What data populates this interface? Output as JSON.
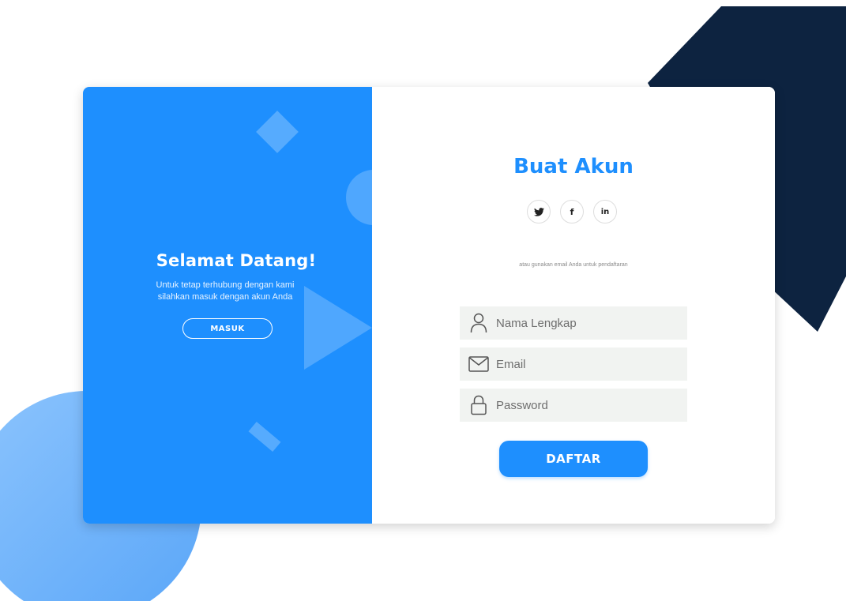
{
  "colors": {
    "accent": "#1e8ffe",
    "dark_shape": "#0d2340",
    "light_shape": "#7ab8fb",
    "field_bg": "#f1f3f1"
  },
  "welcome": {
    "title": "Selamat Datang!",
    "line1": "Untuk tetap terhubung dengan kami",
    "line2": "silahkan masuk dengan akun  Anda",
    "login_button": "MASUK"
  },
  "signup": {
    "title": "Buat Akun",
    "social": [
      {
        "icon": "twitter-icon",
        "glyph": "🐦"
      },
      {
        "icon": "facebook-icon",
        "glyph": "f"
      },
      {
        "icon": "linkedin-icon",
        "glyph": "in"
      }
    ],
    "hint": "atau gunakan email Anda untuk pendaftaran",
    "fields": {
      "name": {
        "placeholder": "Nama Lengkap",
        "icon": "user-icon"
      },
      "email": {
        "placeholder": "Email",
        "icon": "mail-icon"
      },
      "password": {
        "placeholder": "Password",
        "icon": "lock-icon"
      }
    },
    "submit_button": "DAFTAR"
  }
}
